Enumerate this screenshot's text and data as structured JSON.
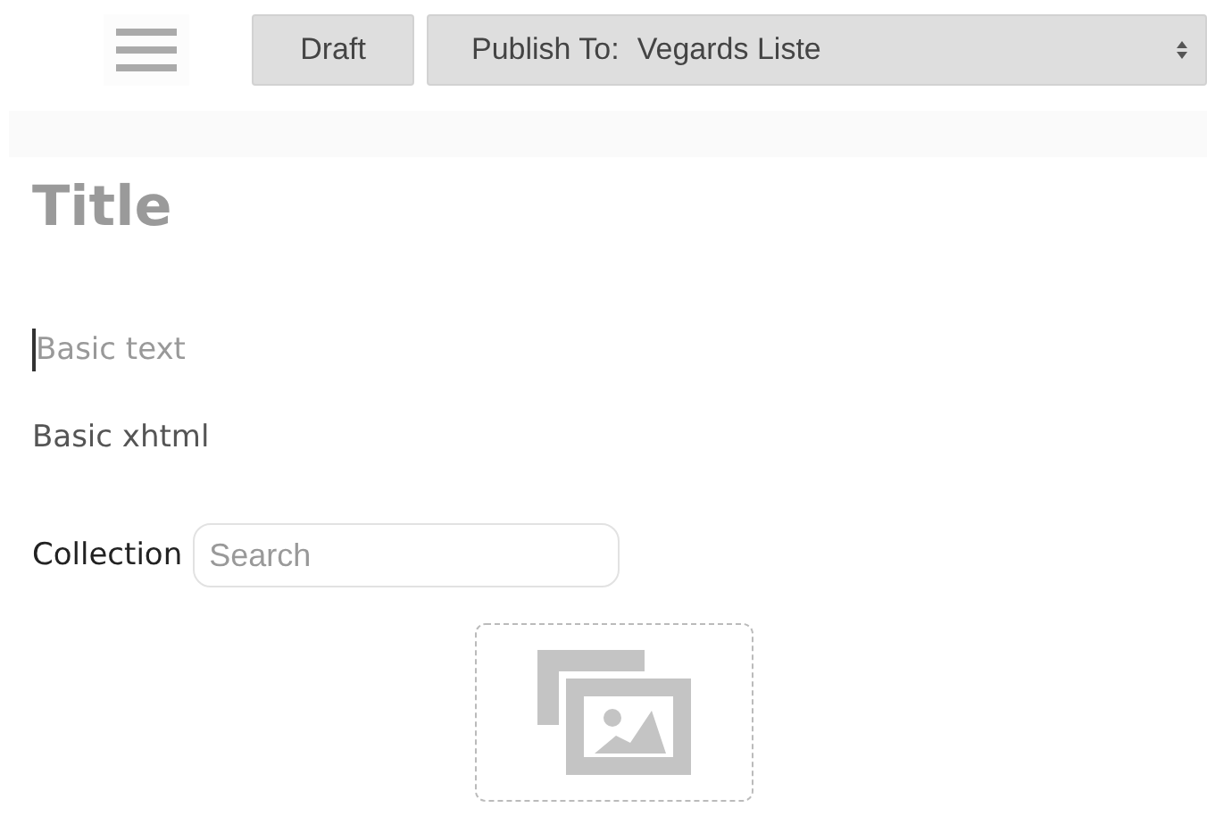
{
  "toolbar": {
    "draft_button": "Draft",
    "publish": {
      "label": "Publish To:",
      "value": "Vegards Liste"
    }
  },
  "title_field": {
    "placeholder": "Title"
  },
  "text_field": {
    "placeholder": "Basic text",
    "focused": true
  },
  "xhtml_label": "Basic xhtml",
  "collection": {
    "label": "Collection",
    "search": {
      "placeholder": "Search"
    }
  }
}
